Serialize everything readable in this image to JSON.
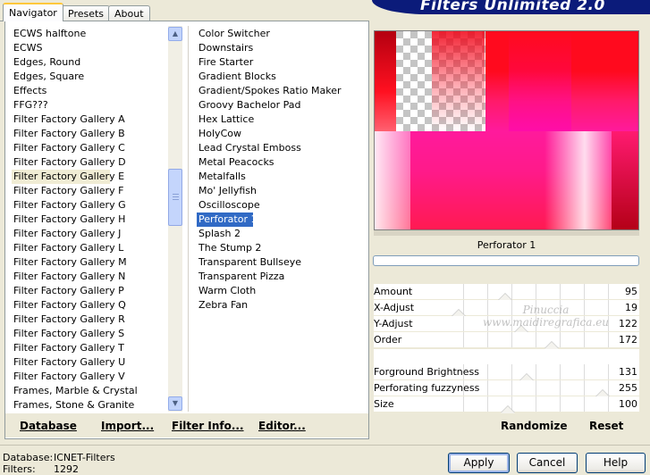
{
  "tabs": [
    {
      "label": "Navigator"
    },
    {
      "label": "Presets"
    },
    {
      "label": "About"
    }
  ],
  "banner": {
    "title": "Filters Unlimited 2.0"
  },
  "categories": [
    {
      "label": "ECWS halftone"
    },
    {
      "label": "ECWS"
    },
    {
      "label": "Edges, Round"
    },
    {
      "label": "Edges, Square"
    },
    {
      "label": "Effects"
    },
    {
      "label": "FFG???"
    },
    {
      "label": "Filter Factory Gallery A"
    },
    {
      "label": "Filter Factory Gallery B"
    },
    {
      "label": "Filter Factory Gallery C"
    },
    {
      "label": "Filter Factory Gallery D"
    },
    {
      "label": "Filter Factory Gallery E"
    },
    {
      "label": "Filter Factory Gallery F"
    },
    {
      "label": "Filter Factory Gallery G"
    },
    {
      "label": "Filter Factory Gallery H"
    },
    {
      "label": "Filter Factory Gallery J"
    },
    {
      "label": "Filter Factory Gallery L"
    },
    {
      "label": "Filter Factory Gallery M"
    },
    {
      "label": "Filter Factory Gallery N"
    },
    {
      "label": "Filter Factory Gallery P"
    },
    {
      "label": "Filter Factory Gallery Q"
    },
    {
      "label": "Filter Factory Gallery R"
    },
    {
      "label": "Filter Factory Gallery S"
    },
    {
      "label": "Filter Factory Gallery T"
    },
    {
      "label": "Filter Factory Gallery U"
    },
    {
      "label": "Filter Factory Gallery V"
    },
    {
      "label": "Frames, Marble & Crystal"
    },
    {
      "label": "Frames, Stone & Granite"
    }
  ],
  "filters": [
    {
      "label": "Color Switcher"
    },
    {
      "label": "Downstairs"
    },
    {
      "label": "Fire Starter"
    },
    {
      "label": "Gradient Blocks"
    },
    {
      "label": "Gradient/Spokes Ratio Maker"
    },
    {
      "label": "Groovy Bachelor Pad"
    },
    {
      "label": "Hex Lattice"
    },
    {
      "label": "HolyCow"
    },
    {
      "label": "Lead Crystal Emboss"
    },
    {
      "label": "Metal Peacocks"
    },
    {
      "label": "Metalfalls"
    },
    {
      "label": "Mo' Jellyfish"
    },
    {
      "label": "Oscilloscope"
    },
    {
      "label": "Perforator 1"
    },
    {
      "label": "Splash 2"
    },
    {
      "label": "The Stump 2"
    },
    {
      "label": "Transparent Bullseye"
    },
    {
      "label": "Transparent Pizza"
    },
    {
      "label": "Warm Cloth"
    },
    {
      "label": "Zebra Fan"
    }
  ],
  "selected_category": "Filter Factory Gallery E",
  "selected_filter": "Perforator 1",
  "list_buttons": {
    "database": "Database",
    "import": "Import...",
    "filter_info": "Filter Info...",
    "editor": "Editor..."
  },
  "preview": {
    "filter_name": "Perforator 1"
  },
  "sliders_group1": [
    {
      "label": "Amount",
      "value": "95",
      "level": 0.373
    },
    {
      "label": "X-Adjust",
      "value": "19",
      "level": 0.075
    },
    {
      "label": "Y-Adjust",
      "value": "122",
      "level": 0.478
    },
    {
      "label": "Order",
      "value": "172",
      "level": 0.675
    }
  ],
  "sliders_group2": [
    {
      "label": "Forground Brightness",
      "value": "131",
      "level": 0.514
    },
    {
      "label": "Perforating fuzzyness",
      "value": "255",
      "level": 1.0
    },
    {
      "label": "Size",
      "value": "100",
      "level": 0.392
    }
  ],
  "actions": {
    "randomize": "Randomize",
    "reset": "Reset"
  },
  "watermark": {
    "line1": "Pinuccia",
    "line2": "www.maidiregrafica.eu"
  },
  "status": {
    "database_label": "Database:",
    "database_value": "ICNET-Filters",
    "filters_label": "Filters:",
    "filters_value": "1292"
  },
  "buttons": {
    "apply": "Apply",
    "cancel": "Cancel",
    "help": "Help"
  },
  "colors": {
    "selection": "#316ac5",
    "banner": "#0b1b7a",
    "preview_magenta": "#ff1a9c",
    "preview_red": "#ff0a1e"
  }
}
